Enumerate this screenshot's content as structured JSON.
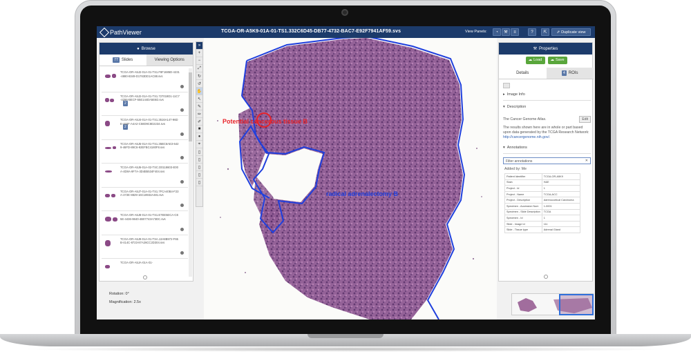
{
  "app": {
    "name": "PathViewer",
    "document_title": "TCGA-OR-A5K9-01A-01-TS1.332C6D45-DB77-4732-BAC7-E92F7941AF59.svs",
    "view_panels_label": "View Panels:",
    "toolbar_buttons": [
      "◔",
      "⚒",
      "≡",
      "?",
      "⇱"
    ],
    "duplicate_label": "Duplicate view"
  },
  "browse_panel": {
    "title": "Browse",
    "tabs": [
      {
        "label": "Slides",
        "count": "77"
      },
      {
        "label": "Viewing Options"
      }
    ],
    "slides": [
      {
        "name": "TCGA-OR-A5J2-01A-01-TS1.F8F1685D-4231-4880-8349-D1763DD1AC88.svs"
      },
      {
        "name": "TCGA-OR-A5J2-01A-01-TS1.727019D1-11C7-4296-BECF-55E144DA5E6D.svs",
        "count": "2"
      },
      {
        "name": "TCGA-OR-A5J4-01A-01-TS1.3516A147-96DE-460F-A4A2-C58D9C8D2234.svs",
        "count": "2"
      },
      {
        "name": "TCGA-OR-A5J5-01A-01-TS1.35BC6AE3-6429-46FD-89C6-92EFBC4180F8.svs"
      },
      {
        "name": "TCGA-OR-A5J6-01A-02-TSC.D0118603-E00A-4D8A-9F7A-3D4B5534F404.svs"
      },
      {
        "name": "TCGA-OR-A5J7-01A-01-TS1.7FCA40B4-F23A-472E-8829-16C18932A481.svs"
      },
      {
        "name": "TCGA-OR-A5J8-01A-01-TS1.E7EE5ECA-CE5E-4436-9840-4B07743A73DC.svs"
      },
      {
        "name": "TCGA-OR-A5J9-01A-01-TSA.13A8B972-F65B-414C-8723-87A26CC2D304.svs"
      },
      {
        "name": "TCGA-OR-A5JA-01A-01-"
      }
    ]
  },
  "status": {
    "rotation": "Rotation: 0°",
    "magnification": "Magnification: 2.5x"
  },
  "tools": [
    "»",
    "+",
    "−",
    "⤢",
    "↻",
    "↺",
    "✋",
    "↖",
    "✎",
    "✏",
    "✐",
    "■",
    "●",
    "⌖",
    "▯",
    "▯",
    "▯",
    "▯",
    "▯"
  ],
  "annotations": {
    "cancer_label": "Potential cancerous tissue B",
    "adrenal_label": "radical adrenalectomy B",
    "cancer_color": "#e8232a",
    "adrenal_color": "#1f3fdd"
  },
  "properties": {
    "title": "Properties",
    "load_label": "Load",
    "save_label": "Save",
    "tabs": [
      {
        "label": "Details"
      },
      {
        "label": "ROIs",
        "count": "4"
      }
    ],
    "image_info": "Image Info",
    "description_title": "Description",
    "description_lead": "The Cancer Genome Atlas.",
    "edit_label": "Edit",
    "description_text": "The results shown here are in whole or part based upon data generated by the TCGA Research Network:",
    "description_link": "http://cancergenome.nih.gov/.",
    "annotations_title": "Annotations",
    "filter_placeholder": "Filter annotations",
    "added_by": "Added by: Me",
    "table": [
      [
        "Patient Identifier",
        "TCGA-OR-A5K9"
      ],
      [
        "Stain",
        "H&E"
      ],
      [
        "Project - Id",
        "1"
      ],
      [
        "Project - Name",
        "TCGA-ACC"
      ],
      [
        "Project - Description",
        "Adrenocortical Carcinoma"
      ],
      [
        "Specimen - Accession Num",
        "1-0001"
      ],
      [
        "Specimen - Slide Description",
        "TCGA"
      ],
      [
        "Specimen - Id",
        "1"
      ],
      [
        "Slide - Image Id",
        "111"
      ],
      [
        "Slide - Tissue type",
        "Adrenal Gland"
      ]
    ]
  },
  "colors": {
    "header": "#1c3b6b",
    "tissue": "#8b4a86",
    "button_green": "#59a63b"
  }
}
